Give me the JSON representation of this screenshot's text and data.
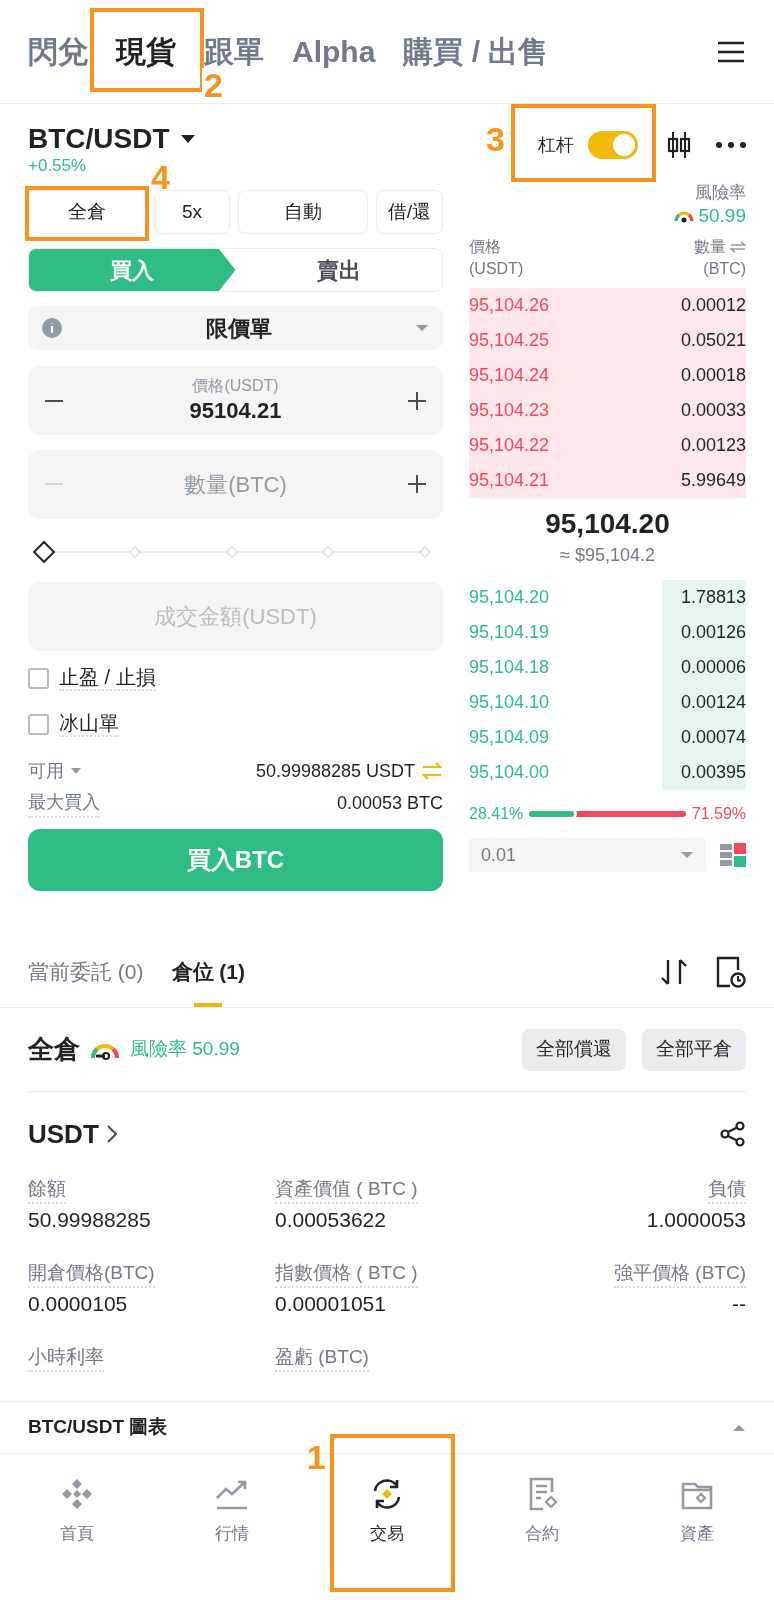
{
  "top_tabs": [
    {
      "label": "閃兌",
      "selected": false
    },
    {
      "label": "現貨",
      "selected": true,
      "annotation": "2"
    },
    {
      "label": "跟單",
      "selected": false
    },
    {
      "label": "Alpha",
      "selected": false
    },
    {
      "label": "購買 / 出售",
      "selected": false
    }
  ],
  "pair": {
    "symbol": "BTC/USDT",
    "change": "+0.55%"
  },
  "leverage": {
    "label": "杠杆",
    "on": true,
    "annotation": "3"
  },
  "margin_buttons": [
    {
      "label": "全倉",
      "annotation": "4"
    },
    {
      "label": "5x"
    },
    {
      "label": "自動"
    },
    {
      "label": "借/還"
    }
  ],
  "side_tabs": [
    {
      "label": "買入",
      "selected": true
    },
    {
      "label": "賣出",
      "selected": false
    }
  ],
  "order_type": "限價單",
  "price_field": {
    "label": "價格(USDT)",
    "value": "95104.21"
  },
  "quantity_field": {
    "placeholder": "數量(BTC)"
  },
  "slider": {
    "level": 0
  },
  "amount_field": {
    "placeholder": "成交金額(USDT)"
  },
  "options": [
    {
      "label": "止盈 / 止損",
      "checked": false
    },
    {
      "label": "冰山單",
      "checked": false
    }
  ],
  "available": {
    "label": "可用",
    "value": "50.99988285 USDT"
  },
  "max_buy": {
    "label": "最大買入",
    "value": "0.00053 BTC"
  },
  "buy_button": "買入BTC",
  "risk": {
    "label": "風險率",
    "value": "50.99"
  },
  "order_book": {
    "price_header": "價格",
    "price_unit": "(USDT)",
    "qty_header": "數量",
    "qty_unit": "(BTC)",
    "asks": [
      {
        "price": "95,104.26",
        "qty": "0.00012"
      },
      {
        "price": "95,104.25",
        "qty": "0.05021"
      },
      {
        "price": "95,104.24",
        "qty": "0.00018"
      },
      {
        "price": "95,104.23",
        "qty": "0.00033"
      },
      {
        "price": "95,104.22",
        "qty": "0.00123"
      },
      {
        "price": "95,104.21",
        "qty": "5.99649"
      }
    ],
    "last_price": "95,104.20",
    "last_price_usd": "≈ $95,104.2",
    "bids": [
      {
        "price": "95,104.20",
        "qty": "1.78813"
      },
      {
        "price": "95,104.19",
        "qty": "0.00126"
      },
      {
        "price": "95,104.18",
        "qty": "0.00006"
      },
      {
        "price": "95,104.10",
        "qty": "0.00124"
      },
      {
        "price": "95,104.09",
        "qty": "0.00074"
      },
      {
        "price": "95,104.00",
        "qty": "0.00395"
      }
    ],
    "ratio": {
      "buy": "28.41%",
      "sell": "71.59%",
      "level": 0.2841
    },
    "precision": "0.01"
  },
  "bottom_tabs": [
    {
      "label": "當前委託 (0)",
      "selected": false
    },
    {
      "label": "倉位 (1)",
      "selected": true
    }
  ],
  "position": {
    "mode": "全倉",
    "risk": "風險率 50.99",
    "actions": [
      "全部償還",
      "全部平倉"
    ],
    "asset": "USDT",
    "stats": [
      {
        "label": "餘額",
        "value": "50.99988285"
      },
      {
        "label": "資產價值 ( BTC )",
        "value": "0.00053622"
      },
      {
        "label": "負債",
        "value": "1.0000053"
      },
      {
        "label": "開倉價格(BTC)",
        "value": "0.0000105"
      },
      {
        "label": "指數價格 ( BTC )",
        "value": "0.00001051"
      },
      {
        "label": "強平價格 (BTC)",
        "value": "--"
      },
      {
        "label": "小時利率"
      },
      {
        "label": "盈虧 (BTC)"
      }
    ]
  },
  "chart_bar": "BTC/USDT 圖表",
  "nav": [
    {
      "label": "首頁",
      "selected": false
    },
    {
      "label": "行情",
      "selected": false
    },
    {
      "label": "交易",
      "selected": true,
      "annotation": "1"
    },
    {
      "label": "合約",
      "selected": false
    },
    {
      "label": "資產",
      "selected": false
    }
  ]
}
